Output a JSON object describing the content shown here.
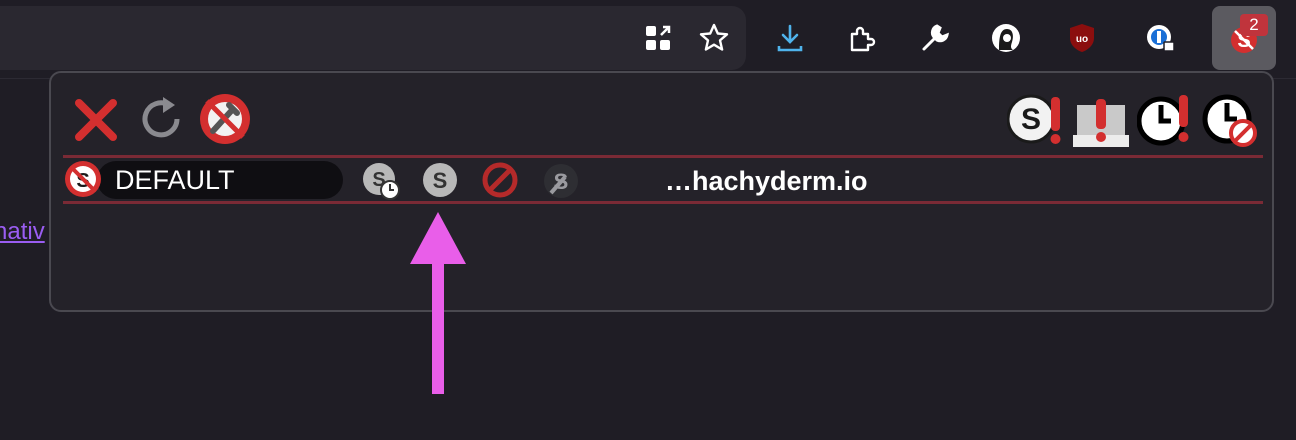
{
  "toolbar": {
    "icons": [
      "apps-grid-icon",
      "bookmark-star-icon",
      "download-icon",
      "puzzle-extensions-icon",
      "wrench-icon",
      "profile-avatar-icon",
      "ublock-icon",
      "password-manager-icon",
      "noscript-icon"
    ],
    "badge_count": "2"
  },
  "page": {
    "link_text": "nativ"
  },
  "popup": {
    "top_left_icons": [
      "close-icon",
      "reload-icon",
      "options-icon"
    ],
    "top_right_icons": [
      "temp-allow-all-icon",
      "disable-restrictions-icon",
      "temp-trust-page-icon",
      "revoke-temp-icon"
    ],
    "row": {
      "scope_label": "DEFAULT",
      "site": "…hachyderm.io",
      "preset_icons": [
        "temp-trusted-icon",
        "trusted-icon",
        "untrusted-icon",
        "custom-icon"
      ]
    }
  },
  "colors": {
    "background": "#1f1d25",
    "popup": "#242229",
    "noscript_red": "#d32f2f",
    "arrow": "#e95ee9",
    "link": "#9a5df2"
  }
}
